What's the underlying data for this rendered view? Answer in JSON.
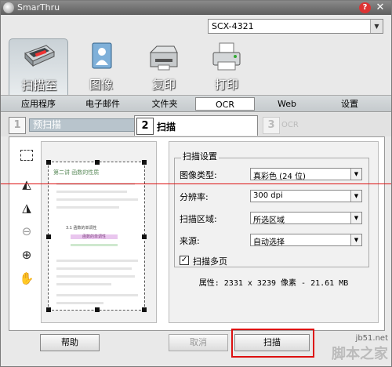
{
  "window": {
    "title": "SmarThru",
    "help": "?",
    "close": "✕"
  },
  "device": {
    "selected": "SCX-4321"
  },
  "function_tabs": [
    {
      "label": "扫描至",
      "icon": "scanner-icon"
    },
    {
      "label": "图像",
      "icon": "image-icon"
    },
    {
      "label": "复印",
      "icon": "copier-icon"
    },
    {
      "label": "打印",
      "icon": "printer-icon"
    }
  ],
  "sub_tabs": [
    {
      "label": "应用程序"
    },
    {
      "label": "电子邮件"
    },
    {
      "label": "文件夹"
    },
    {
      "label": "OCR"
    },
    {
      "label": "Web"
    },
    {
      "label": "设置"
    }
  ],
  "steps": [
    {
      "num": "1",
      "label": "预扫描"
    },
    {
      "num": "2",
      "label": "扫描"
    },
    {
      "num": "3",
      "label": "OCR"
    }
  ],
  "preview": {
    "heading": "第二讲  函数的性质",
    "line1": "3.1  函数的单调性",
    "line2": "函数的单调性"
  },
  "settings": {
    "group_title": "扫描设置",
    "image_type": {
      "label": "图像类型:",
      "value": "真彩色 (24 位)"
    },
    "resolution": {
      "label": "分辨率:",
      "value": "300 dpi"
    },
    "scan_area": {
      "label": "扫描区域:",
      "value": "所选区域"
    },
    "source": {
      "label": "来源:",
      "value": "自动选择"
    },
    "multi_page": {
      "label": "扫描多页",
      "checked": true,
      "mark": "✓"
    },
    "properties": "属性: 2331 x 3239 像素 - 21.61 MB"
  },
  "buttons": {
    "help": "帮助",
    "cancel": "取消",
    "scan": "扫描"
  },
  "watermark": {
    "url": "jb51.net",
    "name": "脚本之家"
  }
}
